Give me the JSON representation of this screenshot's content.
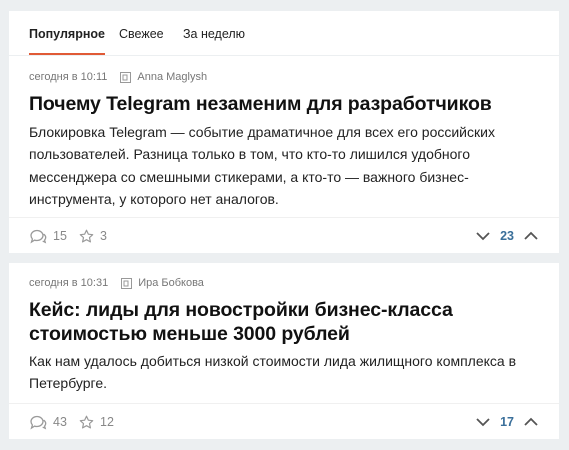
{
  "tabs": [
    {
      "label": "Популярное",
      "active": true
    },
    {
      "label": "Свежее",
      "active": false
    },
    {
      "label": "За неделю",
      "active": false
    }
  ],
  "posts": [
    {
      "time": "сегодня в 10:11",
      "author": "Anna Maglysh",
      "title": "Почему Telegram незаменим для разработчиков",
      "lead": "Блокировка Telegram — событие драматичное для всех его российских пользователей. Разница только в том, что кто-то лишился удобного мессенджера со смешными стикерами, а кто-то — важного бизнес-инструмента, у которого нет аналогов.",
      "comments": "15",
      "favorites": "3",
      "rating": "23"
    },
    {
      "time": "сегодня в 10:31",
      "author": "Ира Бобкова",
      "title": "Кейс: лиды для новостройки бизнес-класса стоимостью меньше 3000 рублей",
      "lead": "Как нам удалось добиться низкой стоимости лида жилищного комплекса в Петербурге.",
      "comments": "43",
      "favorites": "12",
      "rating": "17"
    }
  ],
  "colors": {
    "accent": "#e05a36",
    "rating": "#3a6f9a",
    "background": "#eceff1"
  },
  "icons": {
    "comments": "speech-bubbles-icon",
    "favorites": "star-icon",
    "author": "company-logo-icon",
    "vote_down": "chevron-down-icon",
    "vote_up": "chevron-up-icon"
  }
}
